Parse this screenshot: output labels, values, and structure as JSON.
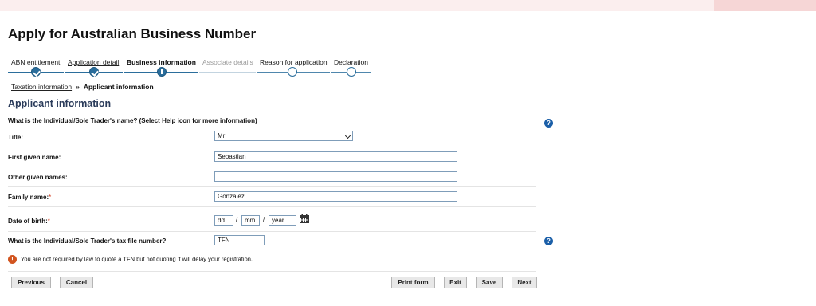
{
  "page": {
    "title": "Apply for Australian Business Number"
  },
  "steps": [
    {
      "label": "ABN entitlement",
      "state": "done"
    },
    {
      "label": "Application detail",
      "state": "done"
    },
    {
      "label": "Business information",
      "state": "current"
    },
    {
      "label": "Associate details",
      "state": "disabled"
    },
    {
      "label": "Reason for application",
      "state": "future"
    },
    {
      "label": "Declaration",
      "state": "future"
    }
  ],
  "breadcrumb": {
    "link": "Taxation information",
    "separator": "»",
    "current": "Applicant information"
  },
  "section": {
    "title": "Applicant information"
  },
  "question": "What is the Individual/Sole Trader's name? (Select Help icon for more information)",
  "form": {
    "title": {
      "label": "Title:",
      "value": "Mr"
    },
    "first_given_name": {
      "label": "First given name:",
      "value": "Sebastian"
    },
    "other_given_names": {
      "label": "Other given names:",
      "value": ""
    },
    "family_name": {
      "label": "Family name:",
      "required": "*",
      "value": "Gonzalez"
    },
    "dob": {
      "label": "Date of birth:",
      "required": "*",
      "dd": "dd",
      "mm": "mm",
      "year": "year",
      "sep": "/"
    },
    "tfn": {
      "label": "What is the Individual/Sole Trader's tax file number?",
      "value": "TFN"
    }
  },
  "notice": "You are not required by law to quote a TFN but not quoting it will delay your registration.",
  "buttons": {
    "previous": "Previous",
    "cancel": "Cancel",
    "print": "Print form",
    "exit": "Exit",
    "save": "Save",
    "next": "Next"
  },
  "help_icon_text": "?",
  "warn_icon_text": "!",
  "colors": {
    "accent": "#2b6e9c",
    "section_title": "#2a3b5a",
    "help": "#1b5fa8",
    "warn": "#d2541f",
    "required": "#d23a1c"
  }
}
